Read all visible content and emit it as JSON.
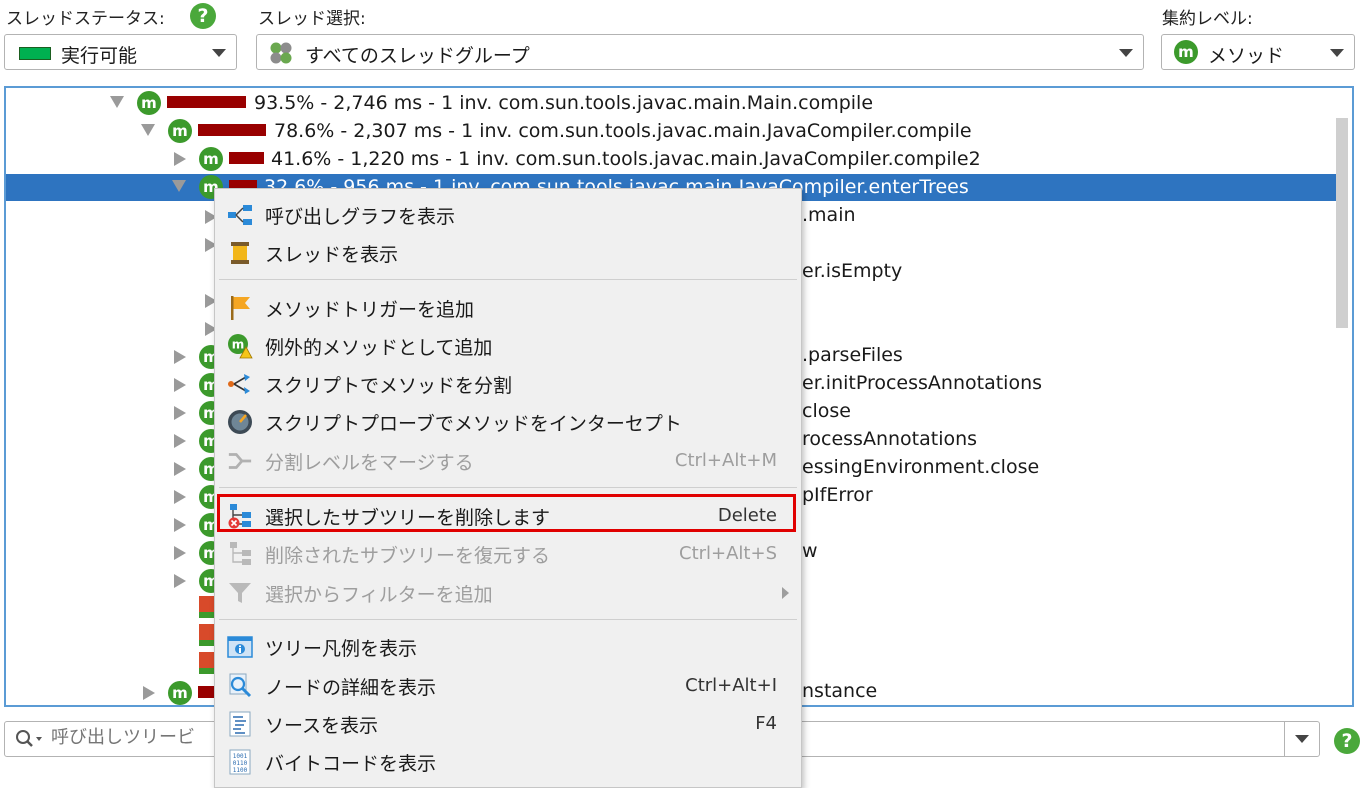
{
  "header": {
    "thread_status_label": "スレッドステータス:",
    "thread_status_value": "実行可能",
    "thread_select_label": "スレッド選択:",
    "thread_select_value": "すべてのスレッドグループ",
    "aggregation_label": "集約レベル:",
    "aggregation_value": "メソッド",
    "help_glyph": "?"
  },
  "tree": {
    "rows": [
      {
        "text": "93.5% - 2,746 ms - 1 inv. com.sun.tools.javac.main.Main.compile",
        "percent": 93.5
      },
      {
        "text": "78.6% - 2,307 ms - 1 inv. com.sun.tools.javac.main.JavaCompiler.compile",
        "percent": 78.6
      },
      {
        "text": "41.6% - 1,220 ms - 1 inv. com.sun.tools.javac.main.JavaCompiler.compile2",
        "percent": 41.6
      },
      {
        "text": "32.6% - 956 ms - 1 inv. com.sun.tools.javac.main.JavaCompiler.enterTrees",
        "percent": 32.6
      }
    ],
    "fragments": [
      ".main",
      "er.isEmpty",
      ".parseFiles",
      "er.initProcessAnnotations",
      "close",
      "rocessAnnotations",
      "essingEnvironment.close",
      "pIfError",
      "w",
      "nstance"
    ],
    "method_icon_letter": "m"
  },
  "context_menu": {
    "items": [
      {
        "label": "呼び出しグラフを表示",
        "shortcut": "",
        "icon": "call-graph-icon"
      },
      {
        "label": "スレッドを表示",
        "shortcut": "",
        "icon": "thread-spool-icon"
      },
      {
        "label": "メソッドトリガーを追加",
        "shortcut": "",
        "icon": "flag-icon"
      },
      {
        "label": "例外的メソッドとして追加",
        "shortcut": "",
        "icon": "exceptional-method-icon"
      },
      {
        "label": "スクリプトでメソッドを分割",
        "shortcut": "",
        "icon": "split-icon"
      },
      {
        "label": "スクリプトプローブでメソッドをインターセプト",
        "shortcut": "",
        "icon": "probe-gauge-icon"
      },
      {
        "label": "分割レベルをマージする",
        "shortcut": "Ctrl+Alt+M",
        "icon": "merge-icon",
        "disabled": true
      },
      {
        "label": "選択したサブツリーを削除します",
        "shortcut": "Delete",
        "icon": "remove-subtree-icon"
      },
      {
        "label": "削除されたサブツリーを復元する",
        "shortcut": "Ctrl+Alt+S",
        "icon": "restore-subtree-icon",
        "disabled": true
      },
      {
        "label": "選択からフィルターを追加",
        "shortcut": "",
        "icon": "filter-icon",
        "disabled": true
      },
      {
        "label": "ツリー凡例を表示",
        "shortcut": "",
        "icon": "legend-icon"
      },
      {
        "label": "ノードの詳細を表示",
        "shortcut": "Ctrl+Alt+I",
        "icon": "magnifier-icon"
      },
      {
        "label": "ソースを表示",
        "shortcut": "F4",
        "icon": "source-icon"
      },
      {
        "label": "バイトコードを表示",
        "shortcut": "",
        "icon": "bytecode-icon"
      }
    ]
  },
  "search": {
    "placeholder": "呼び出しツリービ"
  },
  "colors": {
    "accent_selection": "#2e74c0",
    "bar": "#990000",
    "method_green": "#3c9a2c",
    "highlight_box": "#e00000",
    "status_green": "#00b050"
  }
}
